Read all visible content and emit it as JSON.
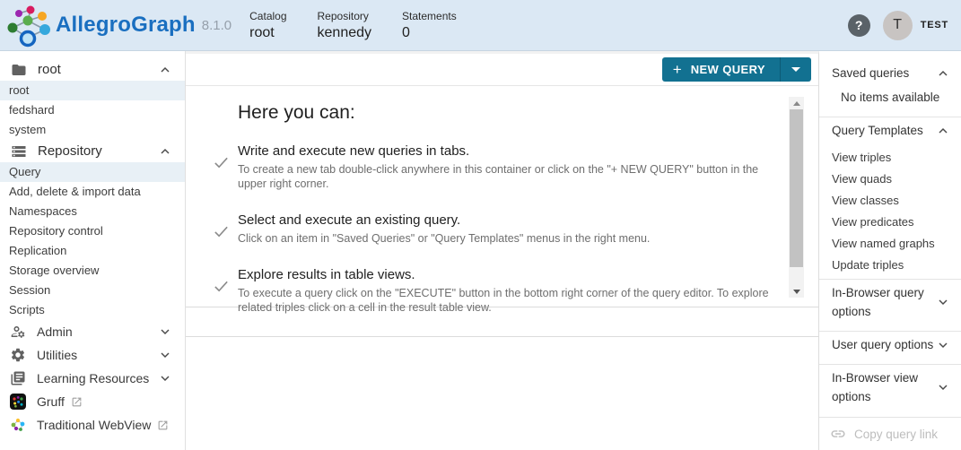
{
  "colors": {
    "accent": "#127191",
    "header_bg": "#dbe8f4",
    "selected_bg": "#e8f0f6"
  },
  "header": {
    "brand": "AllegroGraph",
    "version": "8.1.0",
    "stats": [
      {
        "label": "Catalog",
        "value": "root"
      },
      {
        "label": "Repository",
        "value": "kennedy"
      },
      {
        "label": "Statements",
        "value": "0"
      }
    ],
    "help_glyph": "?",
    "user_initial": "T",
    "user_name": "TEST"
  },
  "left_sidebar": {
    "root_section": {
      "label": "root",
      "items": [
        {
          "label": "root"
        },
        {
          "label": "fedshard"
        },
        {
          "label": "system"
        }
      ]
    },
    "repo_section": {
      "label": "Repository",
      "items": [
        {
          "label": "Query"
        },
        {
          "label": "Add, delete & import data"
        },
        {
          "label": "Namespaces"
        },
        {
          "label": "Repository control"
        },
        {
          "label": "Replication"
        },
        {
          "label": "Storage overview"
        },
        {
          "label": "Session"
        },
        {
          "label": "Scripts"
        }
      ]
    },
    "groups": [
      {
        "label": "Admin"
      },
      {
        "label": "Utilities"
      },
      {
        "label": "Learning Resources"
      }
    ],
    "links": [
      {
        "label": "Gruff"
      },
      {
        "label": "Traditional WebView"
      }
    ]
  },
  "main": {
    "new_query_plus": "+",
    "new_query_label": "NEW QUERY",
    "heading": "Here you can:",
    "items": [
      {
        "title": "Write and execute new queries in tabs.",
        "desc": "To create a new tab double-click anywhere in this container or click on the \"+ NEW QUERY\" button in the upper right corner."
      },
      {
        "title": "Select and execute an existing query.",
        "desc": "Click on an item in \"Saved Queries\" or \"Query Templates\" menus in the right menu."
      },
      {
        "title": "Explore results in table views.",
        "desc": "To execute a query click on the \"EXECUTE\" button in the bottom right corner of the query editor. To explore related triples click on a cell in the result table view."
      }
    ]
  },
  "right_sidebar": {
    "saved_queries": {
      "label": "Saved queries",
      "empty": "No items available"
    },
    "query_templates": {
      "label": "Query Templates",
      "items": [
        "View triples",
        "View quads",
        "View classes",
        "View predicates",
        "View named graphs",
        "Update triples"
      ]
    },
    "options": [
      {
        "label": "In-Browser query options"
      },
      {
        "label": "User query options"
      },
      {
        "label": "In-Browser view options"
      }
    ],
    "copy_link": "Copy query link"
  }
}
